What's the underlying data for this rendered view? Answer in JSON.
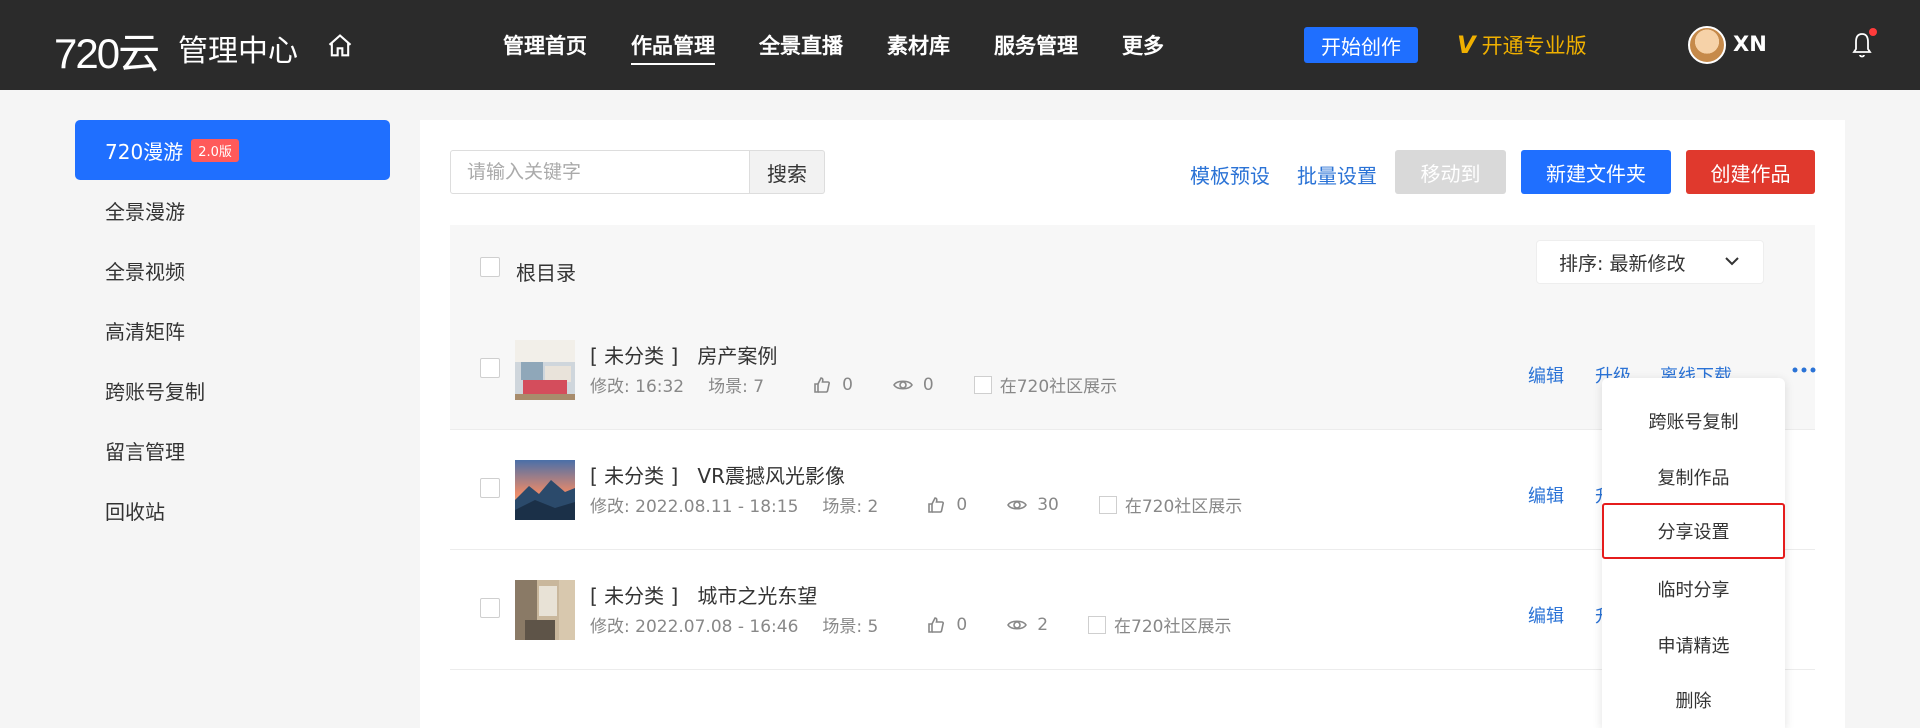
{
  "header": {
    "logo": "720云",
    "title": "管理中心",
    "nav": [
      "管理首页",
      "作品管理",
      "全景直播",
      "素材库",
      "服务管理",
      "更多"
    ],
    "active_nav": "作品管理",
    "create_label": "开始创作",
    "pro_v": "V",
    "pro_label": "开通专业版",
    "username": "XN"
  },
  "sidebar": {
    "active": {
      "label": "720漫游",
      "badge": "2.0版"
    },
    "items": [
      "全景漫游",
      "全景视频",
      "高清矩阵",
      "跨账号复制",
      "留言管理",
      "回收站"
    ]
  },
  "toolbar": {
    "search_placeholder": "请输入关键字",
    "search_label": "搜索",
    "template_label": "模板预设",
    "batch_label": "批量设置",
    "move_label": "移动到",
    "new_folder_label": "新建文件夹",
    "create_label": "创建作品"
  },
  "list": {
    "root_label": "根目录",
    "sort_label": "排序:  最新修改",
    "rows": [
      {
        "category": "[ 未分类 ]",
        "name": "房产案例",
        "modified": "修改: 16:32",
        "scenes": "场景: 7",
        "likes": "0",
        "views": "0",
        "community": "在720社区展示",
        "actions": [
          "编辑",
          "升级",
          "离线下载"
        ]
      },
      {
        "category": "[ 未分类 ]",
        "name": "VR震撼风光影像",
        "modified": "修改: 2022.08.11 - 18:15",
        "scenes": "场景: 2",
        "likes": "0",
        "views": "30",
        "community": "在720社区展示",
        "actions": [
          "编辑",
          "升"
        ]
      },
      {
        "category": "[ 未分类 ]",
        "name": "城市之光东望",
        "modified": "修改: 2022.07.08 - 16:46",
        "scenes": "场景: 5",
        "likes": "0",
        "views": "2",
        "community": "在720社区展示",
        "actions": [
          "编辑",
          "升"
        ]
      }
    ]
  },
  "menu": {
    "items": [
      "跨账号复制",
      "复制作品",
      "分享设置",
      "临时分享",
      "申请精选",
      "删除"
    ],
    "highlighted": "分享设置"
  },
  "colors": {
    "accent": "#1f6fff",
    "danger": "#e0392d",
    "link": "#2b73d6",
    "pro": "#f0b000",
    "topbar": "#2b2b2b"
  }
}
